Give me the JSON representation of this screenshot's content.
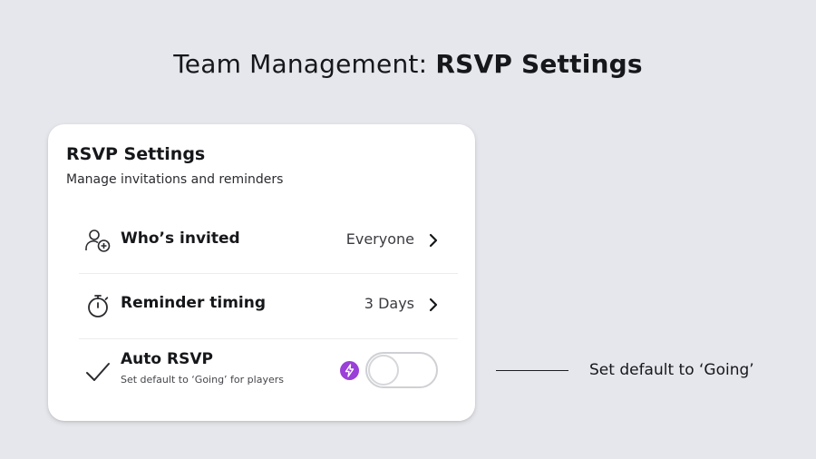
{
  "header": {
    "title_prefix": "Team Management: ",
    "title_emphasis": "RSVP Settings"
  },
  "card": {
    "title": "RSVP Settings",
    "subtitle": "Manage invitations and reminders",
    "rows": [
      {
        "label": "Who’s invited",
        "value": "Everyone",
        "icon": "people-add-icon",
        "chevron": "chevron-right-icon"
      },
      {
        "label": "Reminder timing",
        "value": "3 Days",
        "icon": "stopwatch-icon",
        "chevron": "chevron-right-icon"
      }
    ],
    "auto_rsvp": {
      "label": "Auto RSVP",
      "sublabel": "Set default to ‘Going’ for players",
      "icon": "checkmark-icon",
      "badge_icon": "lightning-bolt-icon",
      "toggle_on": false
    }
  },
  "callout": {
    "text": "Set default to ‘Going’"
  },
  "colors": {
    "background": "#e6e7ec",
    "card": "#ffffff",
    "badge": "#9a3fd8",
    "text": "#16171a"
  }
}
